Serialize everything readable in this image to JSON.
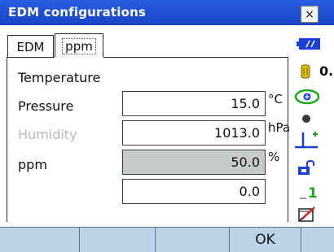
{
  "window": {
    "title": "EDM configurations",
    "close_label": "×"
  },
  "tabs": [
    {
      "label": "EDM",
      "active": false
    },
    {
      "label": "ppm",
      "active": true
    }
  ],
  "form": {
    "rows": [
      {
        "label": "Temperature",
        "value": "15.0",
        "unit": "°C",
        "enabled": true
      },
      {
        "label": "Pressure",
        "value": "1013.0",
        "unit": "hPa",
        "enabled": true
      },
      {
        "label": "Humidity",
        "value": "50.0",
        "unit": "%",
        "enabled": false
      },
      {
        "label": "ppm",
        "value": "0.0",
        "unit": "",
        "enabled": true
      }
    ]
  },
  "status_bar": {
    "partial_text": "0.",
    "icons": [
      "battery-icon",
      "bluetooth-target-icon",
      "ring-icon",
      "prism-icon",
      "level-icon",
      "key-icon",
      "one-icon",
      "edit-icon"
    ]
  },
  "softkeys": [
    "",
    "",
    "",
    "OK",
    ""
  ],
  "colors": {
    "titlebar": "#1f4fd0",
    "softkey_bar": "#bcd3e8",
    "disabled_field": "#c8ccc8",
    "disabled_text": "#b8b8b8",
    "accent_green": "#1aa81a",
    "accent_blue": "#1a3fd8"
  }
}
